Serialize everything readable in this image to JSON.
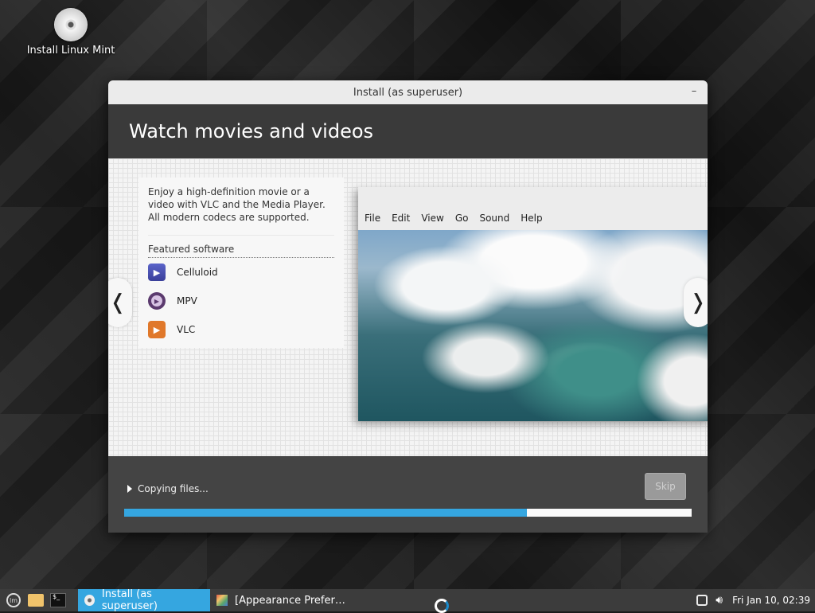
{
  "desktop": {
    "icon_label": "Install Linux Mint"
  },
  "window": {
    "title": "Install (as superuser)",
    "minimize_glyph": "–",
    "header": "Watch movies and videos"
  },
  "slide": {
    "description": "Enjoy a high-definition movie or a video with VLC and the Media Player. All modern codecs are supported.",
    "featured_title": "Featured software",
    "software": [
      {
        "name": "Celluloid",
        "icon": "celluloid-icon"
      },
      {
        "name": "MPV",
        "icon": "mpv-icon"
      },
      {
        "name": "VLC",
        "icon": "vlc-icon"
      }
    ],
    "prev_glyph": "❬",
    "next_glyph": "❭",
    "player_menu": [
      "File",
      "Edit",
      "View",
      "Go",
      "Sound",
      "Help"
    ]
  },
  "progress": {
    "status": "Copying files...",
    "skip_label": "Skip",
    "fraction": 0.71,
    "color": "#35a6e0"
  },
  "taskbar": {
    "items": [
      {
        "label": "Install (as superuser)",
        "active": true
      },
      {
        "label": "[Appearance Prefer…",
        "active": false
      }
    ],
    "clock": "Fri Jan 10, 02:39"
  }
}
